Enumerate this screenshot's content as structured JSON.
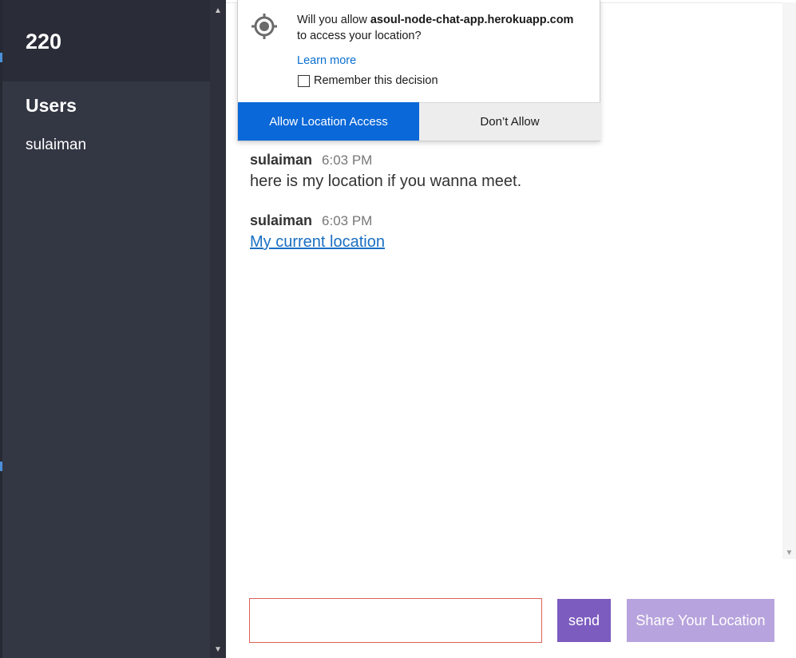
{
  "sidebar": {
    "room_name": "220",
    "users_heading": "Users",
    "users": [
      "sulaiman"
    ]
  },
  "messages": [
    {
      "author": "sulaiman",
      "time": "6:03 PM",
      "text": "here is my location if you wanna meet."
    },
    {
      "author": "sulaiman",
      "time": "6:03 PM",
      "link_text": "My current location"
    }
  ],
  "compose": {
    "input_value": "",
    "send_label": "send",
    "share_location_label": "Share Your Location"
  },
  "location_prompt": {
    "question_prefix": "Will you allow ",
    "site": "asoul-node-chat-app.herokuapp.com",
    "question_suffix": "to access your location?",
    "learn_more": "Learn more",
    "remember_label": "Remember this decision",
    "remember_checked": false,
    "allow_label": "Allow Location Access",
    "deny_label": "Don’t Allow",
    "icon": "location-target-icon"
  },
  "colors": {
    "sidebar_bg": "#333744",
    "sidebar_header_bg": "#2a2d38",
    "send_button": "#7c5cbf",
    "share_button": "#b7a3dd",
    "allow_button": "#0a68d8",
    "link": "#1a6fc2",
    "input_border": "#e0605a"
  }
}
